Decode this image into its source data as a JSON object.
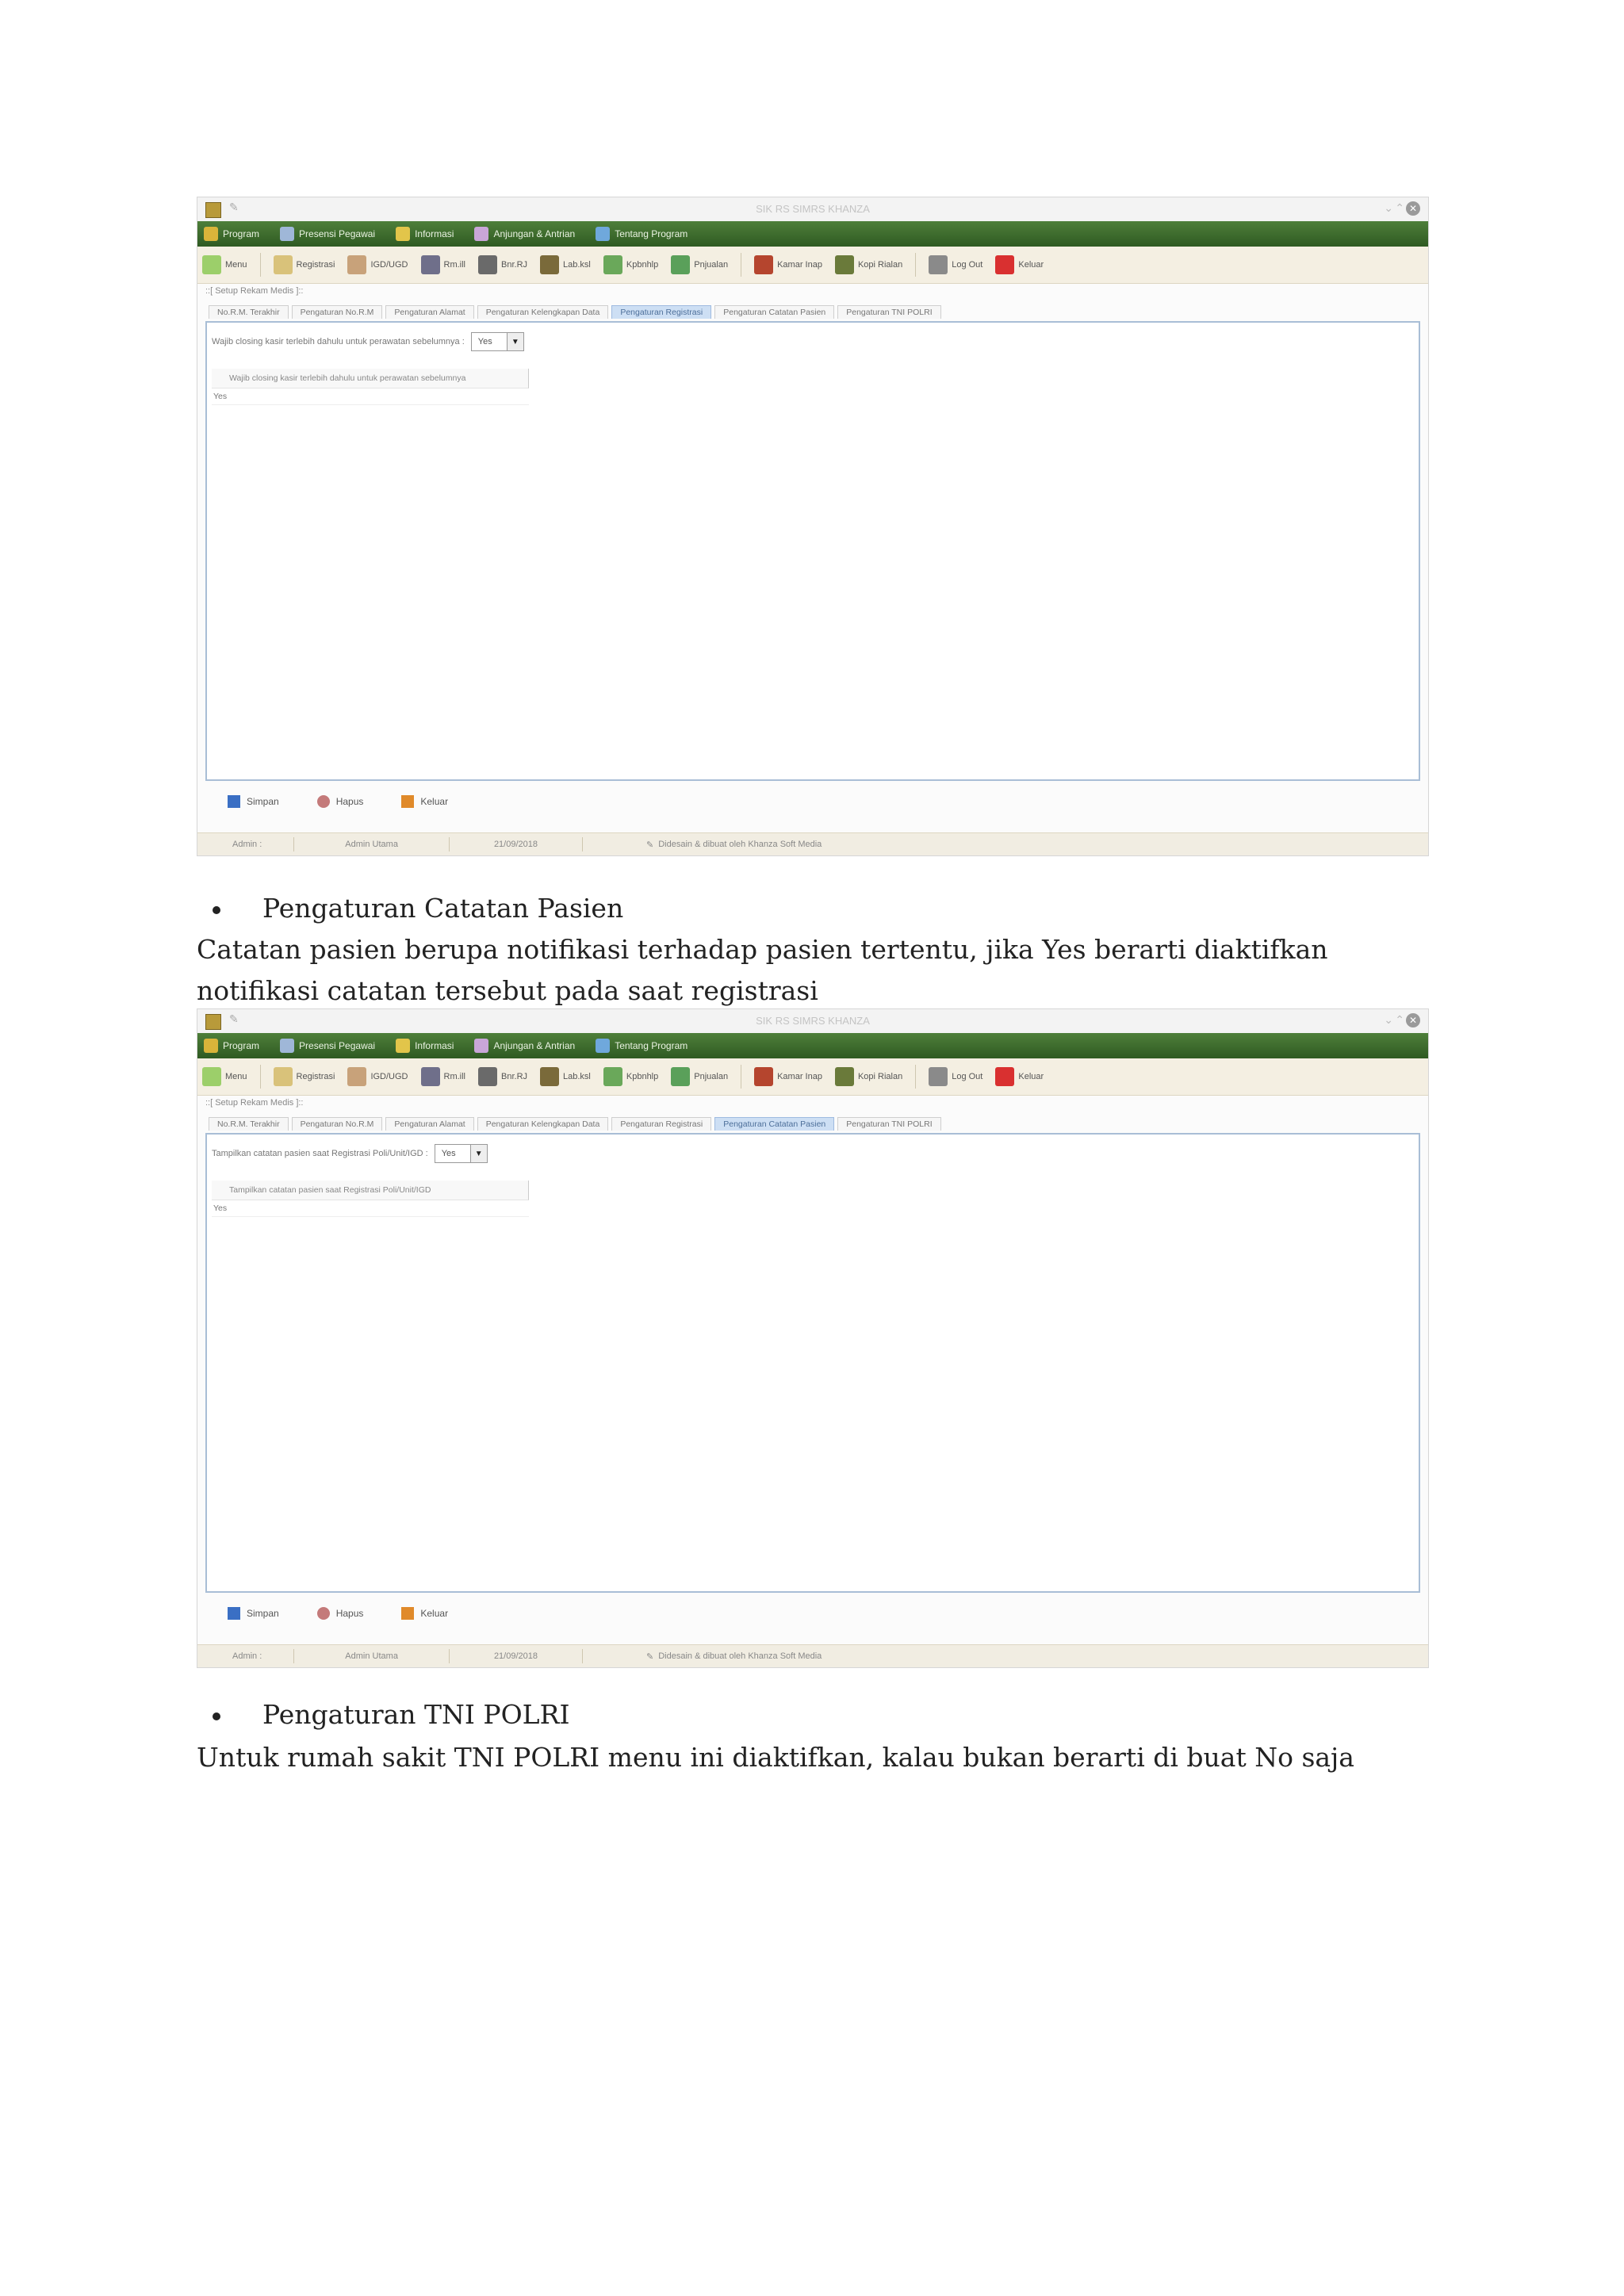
{
  "app": {
    "window_title": "SIK RS SIMRS KHANZA",
    "menus": [
      {
        "label": "Program",
        "color": "#d9b43a"
      },
      {
        "label": "Presensi Pegawai",
        "color": "#9fb7d8"
      },
      {
        "label": "Informasi",
        "color": "#e2c54a"
      },
      {
        "label": "Anjungan & Antrian",
        "color": "#c9a6d8"
      },
      {
        "label": "Tentang Program",
        "color": "#6fa8dc"
      }
    ],
    "toolbar": [
      {
        "label": "Menu",
        "color": "#9ccf6a"
      },
      {
        "label": "Registrasi",
        "color": "#d9c27a"
      },
      {
        "label": "IGD/UGD",
        "color": "#c8a27a"
      },
      {
        "label": "Rm.ill",
        "color": "#6f6f8a"
      },
      {
        "label": "Bnr.RJ",
        "color": "#6a6a6a"
      },
      {
        "label": "Lab.ksl",
        "color": "#7a6a3a"
      },
      {
        "label": "Kpbnhlp",
        "color": "#6aa85a"
      },
      {
        "label": "Pnjualan",
        "color": "#5aa05a"
      },
      {
        "label": "Kamar Inap",
        "color": "#b5452e"
      },
      {
        "label": "Kopi Rialan",
        "color": "#6a7a3a"
      },
      {
        "label": "Log Out",
        "color": "#8a8a8a"
      },
      {
        "label": "Keluar",
        "color": "#d93030"
      }
    ],
    "breadcrumb": "::[ Setup Rekam Medis ]::",
    "tabs": [
      "No.R.M. Terakhir",
      "Pengaturan No.R.M",
      "Pengaturan Alamat",
      "Pengaturan Kelengkapan Data",
      "Pengaturan Registrasi",
      "Pengaturan Catatan Pasien",
      "Pengaturan TNI POLRI"
    ],
    "actions": {
      "save": "Simpan",
      "delete": "Hapus",
      "exit": "Keluar"
    },
    "status": {
      "user_label": "Admin :",
      "user_name": "Admin Utama",
      "date": "21/09/2018",
      "credit": "Didesain & dibuat oleh Khanza Soft Media"
    }
  },
  "screenshots": [
    {
      "active_tab": 4,
      "field_label": "Wajib closing kasir terlebih dahulu untuk perawatan sebelumnya :",
      "field_value": "Yes",
      "column_header": "Wajib closing kasir terlebih dahulu untuk perawatan sebelumnya",
      "row_value": "Yes"
    },
    {
      "active_tab": 5,
      "field_label": "Tampilkan catatan pasien saat Registrasi Poli/Unit/IGD :",
      "field_value": "Yes",
      "column_header": "Tampilkan catatan pasien saat Registrasi Poli/Unit/IGD",
      "row_value": "Yes"
    }
  ],
  "doc": {
    "section1_heading": "Pengaturan Catatan Pasien",
    "section1_para": "Catatan pasien berupa notifikasi terhadap pasien tertentu, jika Yes berarti diaktifkan notifikasi catatan tersebut pada saat registrasi",
    "section2_heading": "Pengaturan TNI POLRI",
    "section2_para": "Untuk rumah sakit TNI POLRI menu ini diaktifkan, kalau bukan berarti di buat No saja"
  }
}
